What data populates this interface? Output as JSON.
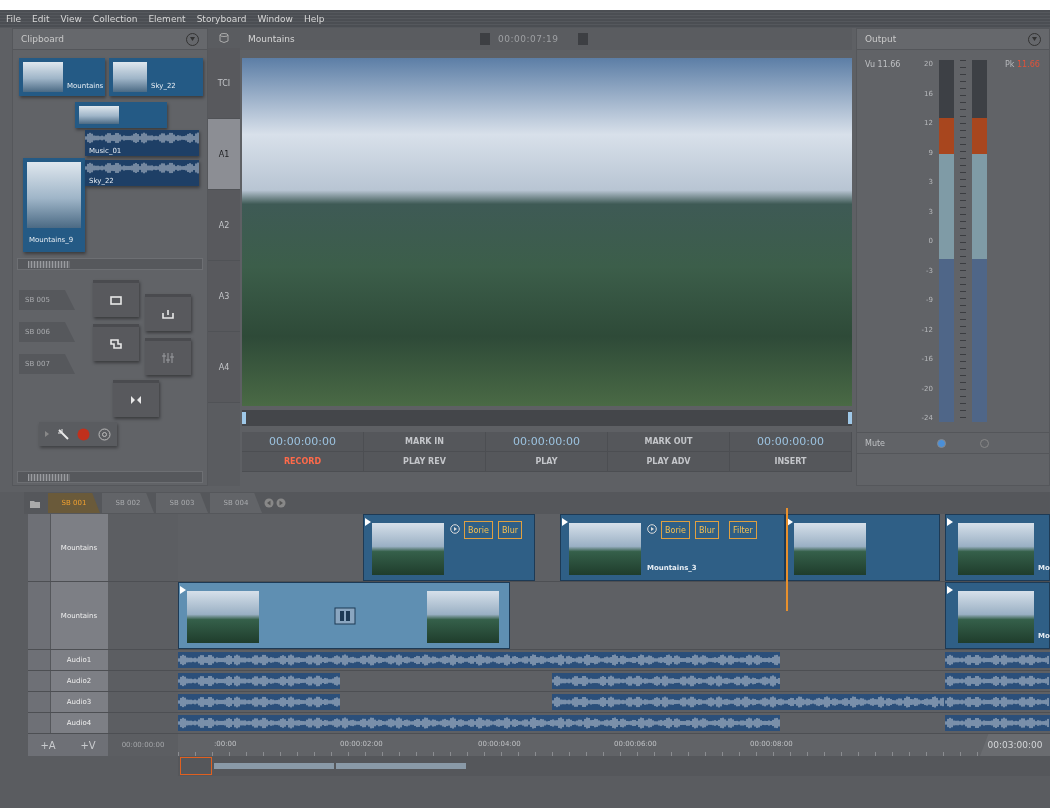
{
  "menu": [
    "File",
    "Edit",
    "View",
    "Collection",
    "Element",
    "Storyboard",
    "Window",
    "Help"
  ],
  "clipboard": {
    "title": "Clipboard",
    "items": [
      {
        "kind": "video",
        "label": "Mountains"
      },
      {
        "kind": "video",
        "label": "Sky_22"
      },
      {
        "kind": "video"
      },
      {
        "kind": "audio",
        "label": "Music_01"
      },
      {
        "kind": "video",
        "label": "Mountains_9"
      },
      {
        "kind": "audio",
        "label": "Sky_22"
      }
    ]
  },
  "storyboards": [
    "SB 005",
    "SB 006",
    "SB 007"
  ],
  "track_selector": [
    {
      "label": "TCI",
      "selected": false
    },
    {
      "label": "A1",
      "selected": true
    },
    {
      "label": "A2",
      "selected": false
    },
    {
      "label": "A3",
      "selected": false
    },
    {
      "label": "A4",
      "selected": false
    }
  ],
  "viewer": {
    "title": "Mountains",
    "timecode": "00:00:07:19"
  },
  "transport": [
    [
      {
        "kind": "timecode",
        "label": "00:00:00:00"
      },
      {
        "kind": "button",
        "label": "MARK IN"
      },
      {
        "kind": "timecode",
        "label": "00:00:00:00"
      },
      {
        "kind": "button",
        "label": "MARK OUT"
      },
      {
        "kind": "timecode",
        "label": "00:00:00:00"
      }
    ],
    [
      {
        "kind": "record",
        "label": "RECORD"
      },
      {
        "kind": "button",
        "label": "PLAY REV"
      },
      {
        "kind": "button",
        "label": "PLAY"
      },
      {
        "kind": "button",
        "label": "PLAY ADV"
      },
      {
        "kind": "button",
        "label": "INSERT"
      }
    ]
  ],
  "output": {
    "title": "Output",
    "vu": "Vu 11.66",
    "pk_label": "Pk",
    "pk_value": "11.66",
    "scale": [
      "20",
      "16",
      "12",
      "9",
      "3",
      "3",
      "0",
      "-3",
      "-9",
      "-12",
      "-16",
      "-20",
      "-24"
    ],
    "meters": [
      {
        "level": 0.84
      },
      {
        "level": 0.84
      }
    ],
    "mute_label": "Mute",
    "mute": [
      {
        "selected": true
      },
      {
        "selected": false
      }
    ]
  },
  "timeline": {
    "tabs": [
      {
        "label": "SB 001",
        "selected": true
      },
      {
        "label": "SB 002",
        "selected": false
      },
      {
        "label": "SB 003",
        "selected": false
      },
      {
        "label": "SB 004",
        "selected": false
      }
    ],
    "tracks": [
      {
        "kind": "video",
        "name": "Mountains",
        "clips": [
          {
            "kind": "video",
            "effects": [
              "Borie",
              "Blur"
            ],
            "transition": false
          },
          {
            "kind": "video",
            "label": "Mountains_3",
            "effects": [
              "Borie",
              "Blur",
              "Filter"
            ],
            "transition": false
          },
          {
            "kind": "video",
            "transition": false
          },
          {
            "kind": "video",
            "label": "Mo",
            "transition": false
          }
        ]
      },
      {
        "kind": "video",
        "name": "Mountains",
        "clips": [
          {
            "kind": "video",
            "transition": true
          },
          {
            "kind": "video",
            "label": "Mo",
            "transition": false
          }
        ]
      },
      {
        "kind": "audio",
        "name": "Audio1",
        "clips": [
          {
            "kind": "audio"
          },
          {
            "kind": "audio"
          }
        ]
      },
      {
        "kind": "audio",
        "name": "Audio2",
        "clips": [
          {
            "kind": "audio"
          },
          {
            "kind": "audio"
          },
          {
            "kind": "audio"
          }
        ]
      },
      {
        "kind": "audio",
        "name": "Audio3",
        "clips": [
          {
            "kind": "audio"
          },
          {
            "kind": "audio"
          },
          {
            "kind": "audio"
          }
        ]
      },
      {
        "kind": "audio",
        "name": "Audio4",
        "clips": [
          {
            "kind": "audio"
          },
          {
            "kind": "audio"
          }
        ]
      }
    ],
    "add_audio": "+A",
    "add_video": "+V",
    "start": "00:00:00:00",
    "ticks": [
      ":00:00",
      "00:00:02:00",
      "00:00:04:00",
      "00:00:06:00",
      "00:00:08:00"
    ],
    "end": "00:03:00:00"
  }
}
